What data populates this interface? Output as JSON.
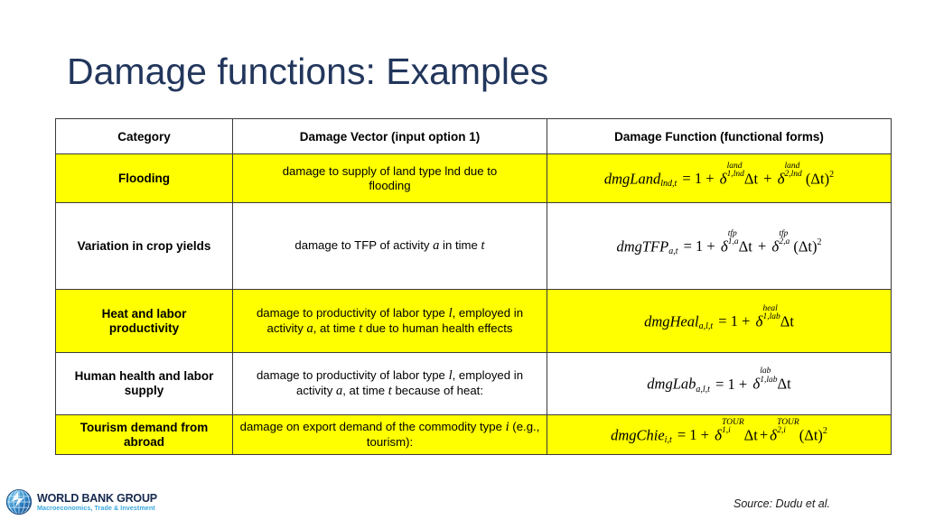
{
  "slide": {
    "title": "Damage functions: Examples",
    "title_color": "#22365c",
    "background": "#ffffff",
    "highlight_color": "#ffff00"
  },
  "table": {
    "headers": {
      "category": "Category",
      "damage_vector": "Damage Vector (input option 1)",
      "damage_function": "Damage Function (functional forms)"
    },
    "rows": [
      {
        "highlight": true,
        "category": "Flooding",
        "vector_text_1": "damage to supply of land type lnd due to",
        "vector_text_2": "flooding",
        "formula_plain": "dmgLand_{lnd,t} = 1 + δ^{land}_{1,lnd}Δt + δ^{land}_{2,lnd} (Δt)^2",
        "f": {
          "name": "dmgLand",
          "name_sub": "lnd,t",
          "eq": " = 1 + ",
          "d1_sup": "land",
          "d1_sub": "1,lnd",
          "dt1": "Δt",
          "plus": " + ",
          "d2_sup": "land",
          "d2_sub": "2,lnd",
          "dt2": " (Δt)",
          "pow": "2"
        }
      },
      {
        "highlight": false,
        "category": "Variation in crop yields",
        "vector_pre": "damage to TFP of activity ",
        "vector_var_a": "a",
        "vector_mid": " in time ",
        "vector_var_t": "t",
        "formula_plain": "dmgTFP_{a,t} = 1 + δ^{tfp}_{1,a}Δt + δ^{tfp}_{2,a} (Δt)^2",
        "f": {
          "name": "dmgTFP",
          "name_sub": "a,t",
          "eq": " = 1 + ",
          "d1_sup": "tfp",
          "d1_sub": "1,a",
          "dt1": "Δt",
          "plus": " + ",
          "d2_sup": "tfp",
          "d2_sub": "2,a",
          "dt2": " (Δt)",
          "pow": "2"
        }
      },
      {
        "highlight": true,
        "category_line1": "Heat and labor",
        "category_line2": "productivity",
        "vector_p1": "damage to productivity of labor type ",
        "vector_v1": "l",
        "vector_p2": ", employed in activity ",
        "vector_v2": "a",
        "vector_p3": ", at time ",
        "vector_v3": "t",
        "vector_p4": " due to human health effects",
        "formula_plain": "dmgHeal_{a,l,t} = 1 + δ^{heal}_{1,lab}Δt",
        "f": {
          "name": "dmgHeal",
          "name_sub": "a,l,t",
          "eq": " = 1 + ",
          "d1_sup": "heal",
          "d1_sub": "1,lab",
          "dt1": "Δt"
        }
      },
      {
        "highlight": false,
        "category_line1": "Human health and labor",
        "category_line2": "supply",
        "vector_p1": "damage to productivity of labor type ",
        "vector_v1": "l",
        "vector_p2": ", employed in activity ",
        "vector_v2": "a",
        "vector_p3": ", at time ",
        "vector_v3": "t",
        "vector_p4": " because of heat:",
        "formula_plain": "dmgLab_{a,l,t} = 1 + δ^{lab}_{1,lab}Δt",
        "f": {
          "name": "dmgLab",
          "name_sub": "a,l,t",
          "eq": " = 1 + ",
          "d1_sup": "lab",
          "d1_sub": "1,lab",
          "dt1": "Δt"
        }
      },
      {
        "highlight": true,
        "category_line1": "Tourism demand from",
        "category_line2": "abroad",
        "vector_p1": "damage on export demand of the commodity type ",
        "vector_v1": "i",
        "vector_p2": " (e.g., tourism):",
        "formula_plain": "dmgChie_{i,t} = 1 + δ^{TOUR}_{1,i}Δt+δ^{TOUR}_{2,i}(Δt)^2",
        "f": {
          "name": "dmgChie",
          "name_sub": "i,t",
          "eq": " = 1 + ",
          "d1_sup": "TOUR",
          "d1_sub": "1,i",
          "dt1": "Δt",
          "plus": "+",
          "d2_sup": "TOUR",
          "d2_sub": "2,i",
          "dt2": "(Δt)",
          "pow": "2"
        }
      }
    ]
  },
  "footer": {
    "logo_name": "WORLD BANK GROUP",
    "logo_tagline": "Macroeconomics, Trade & Investment",
    "source": "Source: Dudu et al."
  }
}
